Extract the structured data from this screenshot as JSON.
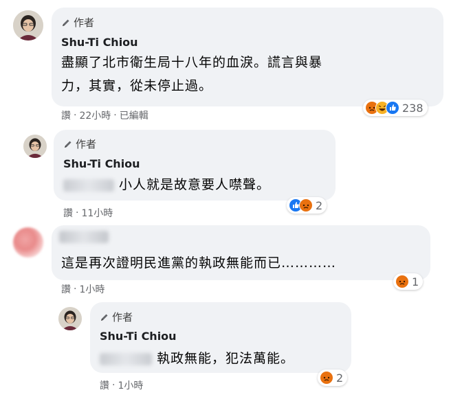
{
  "comments": [
    {
      "author_badge": "作者",
      "author": "Shu-Ti Chiou",
      "lines": [
        "盡顯了北市衛生局十八年的血淚。謊言與暴",
        "力，其實，從未停止過。"
      ],
      "actions": {
        "like": "讚",
        "time": "22小時",
        "edited": "已編輯"
      },
      "reactions": {
        "icons": [
          "angry-icon",
          "haha-icon",
          "like-icon"
        ],
        "count": "238"
      }
    },
    {
      "author_badge": "作者",
      "author": "Shu-Ti Chiou",
      "text": "小人就是故意要人噤聲。",
      "actions": {
        "like": "讚",
        "time": "11小時"
      },
      "reactions": {
        "icons": [
          "like-icon",
          "angry-icon"
        ],
        "count": "2"
      }
    },
    {
      "text": "這是再次證明民進黨的執政無能而已…………",
      "actions": {
        "like": "讚",
        "time": "1小時"
      },
      "reactions": {
        "icons": [
          "angry-icon"
        ],
        "count": "1"
      }
    },
    {
      "author_badge": "作者",
      "author": "Shu-Ti Chiou",
      "text": "執政無能，犯法萬能。",
      "actions": {
        "like": "讚",
        "time": "1小時"
      },
      "reactions": {
        "icons": [
          "angry-icon"
        ],
        "count": "2"
      }
    }
  ],
  "colors": {
    "bubble": "#f0f2f5",
    "meta": "#65676b",
    "like": "#1877f2",
    "angry": "#e9710f",
    "haha": "#f7b125"
  }
}
